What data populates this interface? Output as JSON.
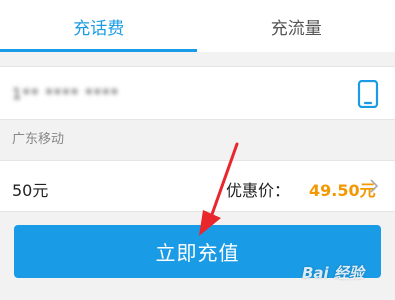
{
  "tabs": [
    {
      "label": "充话费",
      "active": true
    },
    {
      "label": "充流量",
      "active": false
    }
  ],
  "phone": {
    "number": "1** **** ****",
    "icon": "contacts-phone-icon"
  },
  "carrier": "广东移动",
  "amount": {
    "value": "50元",
    "discount_label": "优惠价：",
    "discount_value": "49.50元"
  },
  "button": {
    "label": "立即充值"
  },
  "watermark": {
    "text": "Bai 经验"
  },
  "colors": {
    "accent": "#1a9be6",
    "price": "#f39800",
    "annotation": "#e8262b"
  }
}
